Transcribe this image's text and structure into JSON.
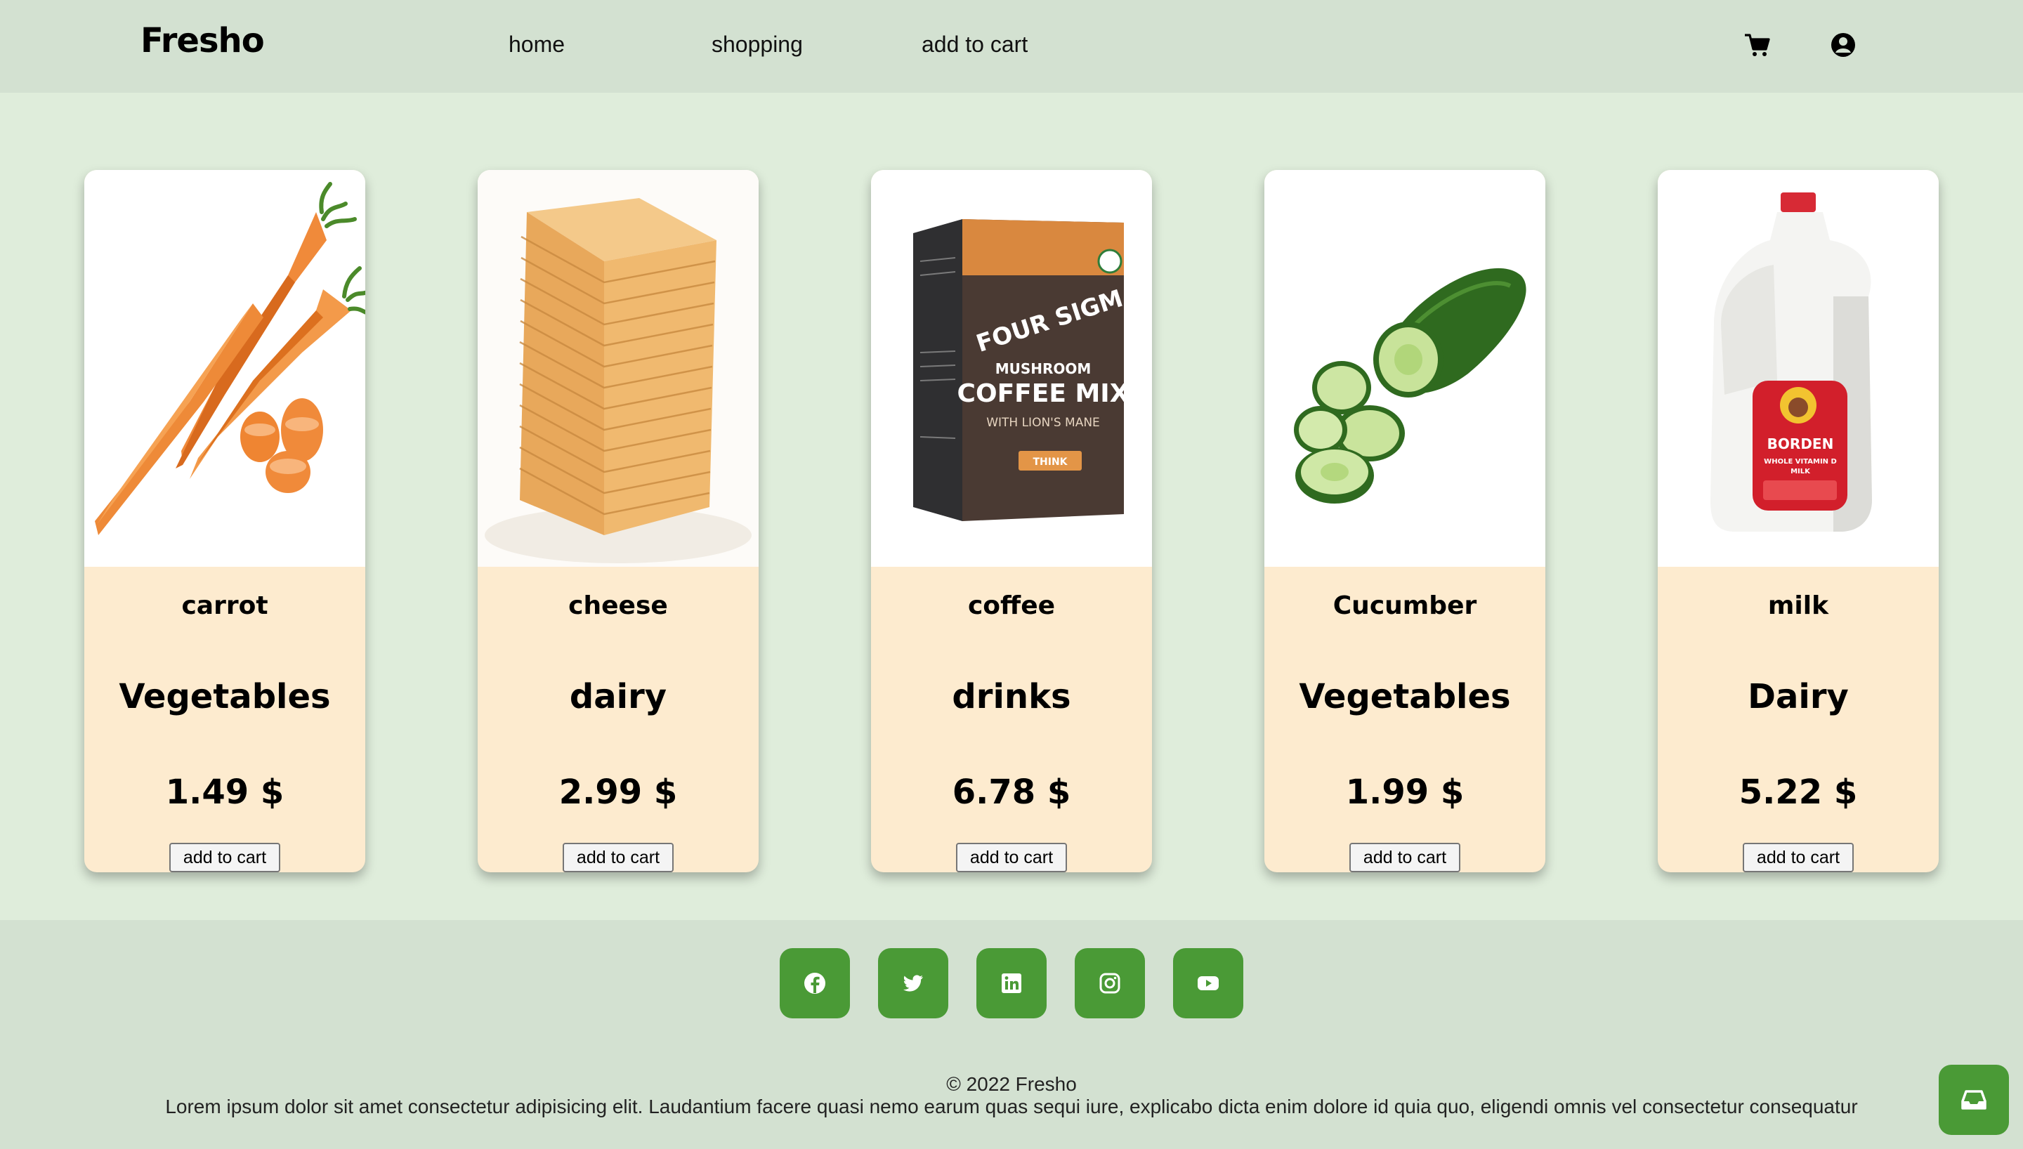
{
  "header": {
    "logo": "Fresho",
    "nav": [
      "home",
      "shopping",
      "add to cart"
    ],
    "icons": [
      "cart-icon",
      "user-circle-icon"
    ]
  },
  "products": [
    {
      "name": "carrot",
      "category": "Vegetables",
      "price": "1.49 $",
      "button": "add to cart",
      "image": "carrot-image"
    },
    {
      "name": "cheese",
      "category": "dairy",
      "price": "2.99 $",
      "button": "add to cart",
      "image": "cheese-image"
    },
    {
      "name": "coffee",
      "category": "drinks",
      "price": "6.78 $",
      "button": "add to cart",
      "image": "coffee-image"
    },
    {
      "name": "Cucumber",
      "category": "Vegetables",
      "price": "1.99 $",
      "button": "add to cart",
      "image": "cucumber-image"
    },
    {
      "name": "milk",
      "category": "Dairy",
      "price": "5.22 $",
      "button": "add to cart",
      "image": "milk-image"
    }
  ],
  "coffee_box": {
    "brand": "FOUR SIGMATIC",
    "line1": "MUSHROOM",
    "line2": "COFFEE MIX",
    "line3": "WITH LION'S MANE",
    "badge": "THINK"
  },
  "milk_label": {
    "brand": "BORDEN",
    "line1": "WHOLE VITAMIN D",
    "line2": "MILK"
  },
  "footer": {
    "social": [
      "facebook-icon",
      "twitter-icon",
      "linkedin-icon",
      "instagram-icon",
      "youtube-icon"
    ],
    "copyright": "© 2022 Fresho",
    "text": "Lorem ipsum dolor sit amet consectetur adipisicing elit. Laudantium facere quasi nemo earum quas sequi iure, explicabo dicta enim dolore id quia quo, eligendi omnis vel consectetur consequatur"
  },
  "colors": {
    "page_bg": "#dfeddb",
    "bar_bg": "#d3e1d1",
    "card_bg": "#fdebcf",
    "accent": "#4a9a36"
  }
}
